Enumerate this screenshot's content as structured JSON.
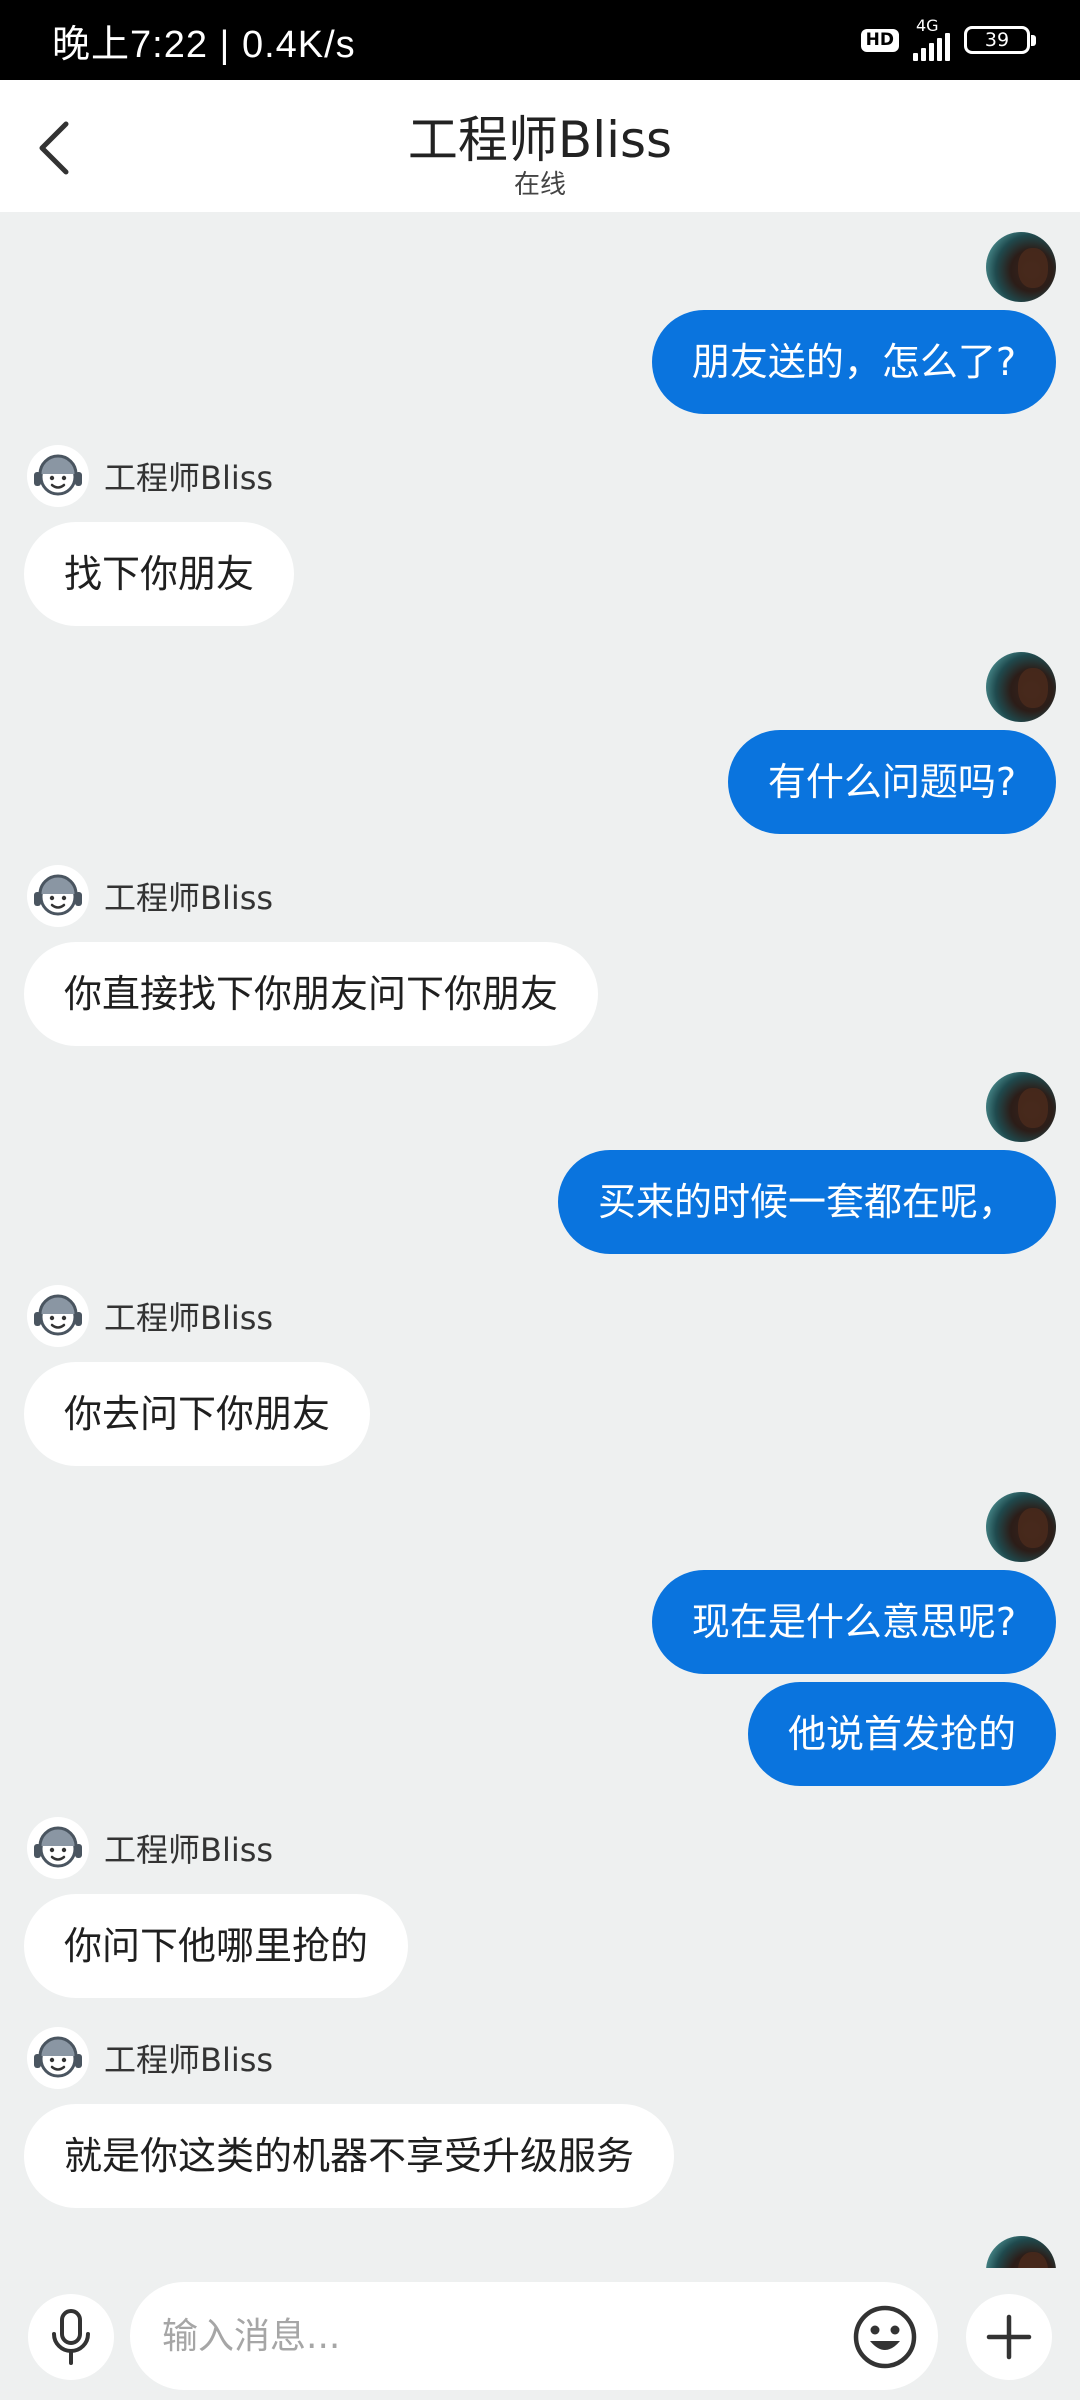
{
  "status_bar": {
    "time_speed": "晚上7:22 | 0.4K/s",
    "hd_label": "HD",
    "network_label": "4G",
    "battery_level": "39"
  },
  "header": {
    "title": "工程师Bliss",
    "subtitle": "在线"
  },
  "agent_name": "工程师Bliss",
  "messages": [
    {
      "from": "me",
      "text": "朋友送的，怎么了?"
    },
    {
      "from": "agent",
      "name": "工程师Bliss",
      "text": "找下你朋友"
    },
    {
      "from": "me",
      "text": "有什么问题吗?"
    },
    {
      "from": "agent",
      "name": "工程师Bliss",
      "text": "你直接找下你朋友问下你朋友"
    },
    {
      "from": "me",
      "text": "买来的时候一套都在呢，"
    },
    {
      "from": "agent",
      "name": "工程师Bliss",
      "text": "你去问下你朋友"
    },
    {
      "from": "me",
      "text": "现在是什么意思呢?"
    },
    {
      "from": "me",
      "text": "他说首发抢的"
    },
    {
      "from": "agent",
      "name": "工程师Bliss",
      "text": "你问下他哪里抢的"
    },
    {
      "from": "agent",
      "name": "工程师Bliss",
      "text": "就是你这类的机器不享受升级服务"
    }
  ],
  "input": {
    "placeholder": "输入消息..."
  },
  "colors": {
    "outgoing_bubble": "#0a74de",
    "incoming_bubble": "#ffffff",
    "chat_background": "#eef0f0"
  },
  "icons": {
    "back": "chevron-left-icon",
    "mic": "microphone-icon",
    "emoji": "smiley-icon",
    "plus": "plus-icon",
    "agent_avatar": "headset-agent-icon"
  }
}
